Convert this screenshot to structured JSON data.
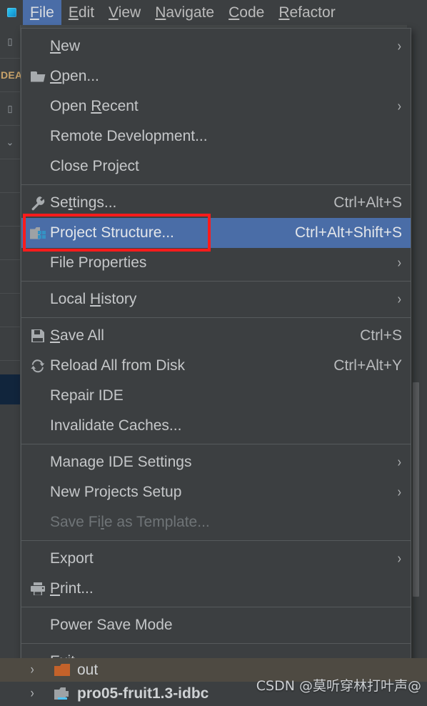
{
  "app": {
    "logo_icon": "intellij-idea-logo-icon",
    "vertical_label": "DEA"
  },
  "menubar": {
    "items": [
      {
        "label": "File",
        "mnemonic": "F",
        "active": true
      },
      {
        "label": "Edit",
        "mnemonic": "E",
        "active": false
      },
      {
        "label": "View",
        "mnemonic": "V",
        "active": false
      },
      {
        "label": "Navigate",
        "mnemonic": "N",
        "active": false
      },
      {
        "label": "Code",
        "mnemonic": "C",
        "active": false
      },
      {
        "label": "Refactor",
        "mnemonic": "R",
        "active": false
      }
    ]
  },
  "file_menu": {
    "groups": [
      {
        "items": [
          {
            "label": "New",
            "mnemonic": "N",
            "icon": "",
            "shortcut": "",
            "submenu": true,
            "selected": false,
            "disabled": false
          },
          {
            "label": "Open...",
            "mnemonic": "O",
            "icon": "folder-open-icon",
            "shortcut": "",
            "submenu": false,
            "selected": false,
            "disabled": false
          },
          {
            "label": "Open Recent",
            "mnemonic": "R",
            "icon": "",
            "shortcut": "",
            "submenu": true,
            "selected": false,
            "disabled": false
          },
          {
            "label": "Remote Development...",
            "mnemonic": "",
            "icon": "",
            "shortcut": "",
            "submenu": false,
            "selected": false,
            "disabled": false
          },
          {
            "label": "Close Project",
            "mnemonic": "",
            "icon": "",
            "shortcut": "",
            "submenu": false,
            "selected": false,
            "disabled": false
          }
        ]
      },
      {
        "items": [
          {
            "label": "Settings...",
            "mnemonic": "t",
            "icon": "wrench-icon",
            "shortcut": "Ctrl+Alt+S",
            "submenu": false,
            "selected": false,
            "disabled": false
          },
          {
            "label": "Project Structure...",
            "mnemonic": "",
            "icon": "project-structure-icon",
            "shortcut": "Ctrl+Alt+Shift+S",
            "submenu": false,
            "selected": true,
            "disabled": false
          },
          {
            "label": "File Properties",
            "mnemonic": "",
            "icon": "",
            "shortcut": "",
            "submenu": true,
            "selected": false,
            "disabled": false
          }
        ]
      },
      {
        "items": [
          {
            "label": "Local History",
            "mnemonic": "H",
            "icon": "",
            "shortcut": "",
            "submenu": true,
            "selected": false,
            "disabled": false
          }
        ]
      },
      {
        "items": [
          {
            "label": "Save All",
            "mnemonic": "S",
            "icon": "floppy-disk-icon",
            "shortcut": "Ctrl+S",
            "submenu": false,
            "selected": false,
            "disabled": false
          },
          {
            "label": "Reload All from Disk",
            "mnemonic": "",
            "icon": "reload-icon",
            "shortcut": "Ctrl+Alt+Y",
            "submenu": false,
            "selected": false,
            "disabled": false
          },
          {
            "label": "Repair IDE",
            "mnemonic": "",
            "icon": "",
            "shortcut": "",
            "submenu": false,
            "selected": false,
            "disabled": false
          },
          {
            "label": "Invalidate Caches...",
            "mnemonic": "",
            "icon": "",
            "shortcut": "",
            "submenu": false,
            "selected": false,
            "disabled": false
          }
        ]
      },
      {
        "items": [
          {
            "label": "Manage IDE Settings",
            "mnemonic": "",
            "icon": "",
            "shortcut": "",
            "submenu": true,
            "selected": false,
            "disabled": false
          },
          {
            "label": "New Projects Setup",
            "mnemonic": "",
            "icon": "",
            "shortcut": "",
            "submenu": true,
            "selected": false,
            "disabled": false
          },
          {
            "label": "Save File as Template...",
            "mnemonic": "l",
            "icon": "",
            "shortcut": "",
            "submenu": false,
            "selected": false,
            "disabled": true
          }
        ]
      },
      {
        "items": [
          {
            "label": "Export",
            "mnemonic": "",
            "icon": "",
            "shortcut": "",
            "submenu": true,
            "selected": false,
            "disabled": false
          },
          {
            "label": "Print...",
            "mnemonic": "P",
            "icon": "printer-icon",
            "shortcut": "",
            "submenu": false,
            "selected": false,
            "disabled": false
          }
        ]
      },
      {
        "items": [
          {
            "label": "Power Save Mode",
            "mnemonic": "",
            "icon": "",
            "shortcut": "",
            "submenu": false,
            "selected": false,
            "disabled": false
          }
        ]
      },
      {
        "items": [
          {
            "label": "Exit",
            "mnemonic": "x",
            "icon": "",
            "shortcut": "",
            "submenu": false,
            "selected": false,
            "disabled": false
          }
        ]
      }
    ]
  },
  "annotation": {
    "shape": "rectangle",
    "color": "#fb1c1c",
    "targets": "Project Structure..."
  },
  "project_tree": {
    "rows": [
      {
        "label": "out",
        "icon": "orange-folder-icon",
        "chevron": "›",
        "bold": false,
        "hovered": true
      },
      {
        "label": "pro05-fruit1.3-idbc",
        "icon": "module-folder-icon",
        "chevron": "›",
        "bold": true,
        "hovered": false
      }
    ]
  },
  "watermark": {
    "text": "CSDN @莫听穿林打叶声@"
  },
  "colors": {
    "menu_background": "#3c3f41",
    "menu_selection": "#4a6da7",
    "menu_text": "#c5c7c9",
    "menu_disabled_text": "#6f7477",
    "annotation_red": "#fb1c1c",
    "accent_blue": "#3592c4",
    "folder_orange": "#c4622a"
  }
}
